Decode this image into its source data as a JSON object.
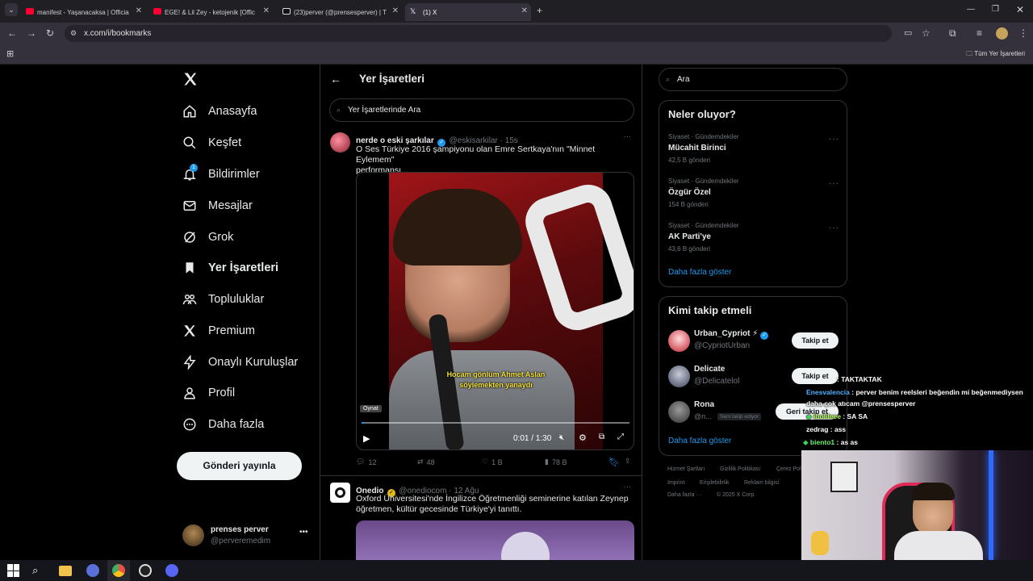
{
  "browser": {
    "tabs": [
      {
        "title": "manifest - Yaşanacaksa | Officia",
        "color": "#ff0033"
      },
      {
        "title": "EGE! & Lil Zey - ketojenik [Offic",
        "color": "#ff0033"
      },
      {
        "title": "(23)perver (@prensesperver) | T",
        "color": "#ffffff"
      },
      {
        "title": "(1) X",
        "color": "#ffffff"
      }
    ],
    "url": "x.com/i/bookmarks",
    "bookmarks_folder": "Tüm Yer İşaretleri"
  },
  "nav": {
    "items": [
      {
        "label": "Anasayfa",
        "icon": "home-icon"
      },
      {
        "label": "Keşfet",
        "icon": "search-icon"
      },
      {
        "label": "Bildirimler",
        "icon": "bell-icon",
        "badge": "1"
      },
      {
        "label": "Mesajlar",
        "icon": "mail-icon"
      },
      {
        "label": "Grok",
        "icon": "grok-icon"
      },
      {
        "label": "Yer İşaretleri",
        "icon": "bookmark-icon"
      },
      {
        "label": "Topluluklar",
        "icon": "people-icon"
      },
      {
        "label": "Premium",
        "icon": "x-icon"
      },
      {
        "label": "Onaylı Kuruluşlar",
        "icon": "lightning-icon"
      },
      {
        "label": "Profil",
        "icon": "person-icon"
      },
      {
        "label": "Daha fazla",
        "icon": "more-circle-icon"
      }
    ],
    "post_button": "Gönderi yayınla",
    "account": {
      "name": "prenses perver",
      "handle": "@perveremedim"
    }
  },
  "main": {
    "title": "Yer İşaretleri",
    "search_placeholder": "Yer İşaretlerinde Ara",
    "tweets": [
      {
        "name": "nerde o eski şarkılar",
        "handle": "@eskisarkilar · 15s",
        "text_line1": "O Ses Türkiye 2016 şampiyonu olan Emre Sertkaya'nın \"Minnet Eylemem\"",
        "text_line2": "performansı...",
        "video": {
          "subtitle1": "Hocam gönlüm Ahmet Aslan",
          "subtitle2": "söylemekten yanaydı",
          "tooltip": "Oynat",
          "time": "0:01 / 1:30",
          "progress": 0.01
        },
        "replies": "12",
        "reposts": "48",
        "likes": "1 B",
        "views": "78 B"
      },
      {
        "name": "Onedio",
        "handle": "@onediocom · 12 Ağu",
        "text_line1": "Oxford Üniversitesi'nde İngilizce Öğretmenliği seminerine katılan Zeynep",
        "text_line2": "öğretmen, kültür gecesinde Türkiye'yi tanıttı."
      }
    ]
  },
  "right": {
    "search_value": "Ara",
    "trends_title": "Neler oluyor?",
    "trends": [
      {
        "category": "Siyaset · Gündemdekiler",
        "name": "Mücahit Birinci",
        "count": "42,5 B gönderi"
      },
      {
        "category": "Siyaset · Gündemdekiler",
        "name": "Özgür Özel",
        "count": "154 B gönderi"
      },
      {
        "category": "Siyaset · Gündemdekiler",
        "name": "AK Parti'ye",
        "count": "43,6 B gönderi"
      }
    ],
    "show_more": "Daha fazla göster",
    "follow_title": "Kimi takip etmeli",
    "follows": [
      {
        "name": "Urban_Cypriot ⚡",
        "handle": "@CypriotUrban",
        "button": "Takip et"
      },
      {
        "name": "Delicate",
        "handle": "@Delicatelol",
        "button": "Takip et"
      },
      {
        "name": "Rona",
        "handle": "@n...",
        "tag": "Seni takip ediyor",
        "button": "Geri takip et"
      }
    ],
    "follow_show_more": "Daha fazla göster",
    "footer": {
      "l1a": "Hizmet Şartları",
      "l1b": "Gizlilik Politikası",
      "l1c": "Çerez Poli",
      "l2a": "Imprint",
      "l2b": "Erişilebilirlik",
      "l2c": "Reklam bilgisi",
      "l3a": "Daha fazla ···",
      "l3b": "© 2025 X Corp."
    }
  },
  "chat": [
    {
      "user": "",
      "text": ": TAKTAKTAK"
    },
    {
      "user": "Enesvalencia",
      "text": ": perver benim reelsleri beğendin mi beğenmediysen"
    },
    {
      "user": "",
      "text": "daha çok atıcam @prensesperver"
    },
    {
      "user": "ibolileee",
      "text": ": SA SA"
    },
    {
      "user": "zedrag",
      "text": ": ass"
    },
    {
      "user": "biento1",
      "text": ": as as"
    }
  ]
}
